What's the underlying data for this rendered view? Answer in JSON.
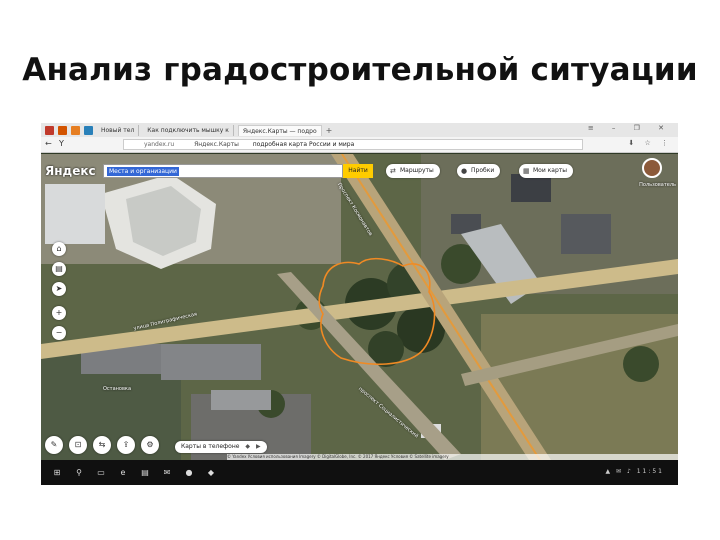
{
  "slide": {
    "title": "Анализ градостроительной ситуации"
  },
  "browser": {
    "tabs": [
      {
        "label": "Новый тел"
      },
      {
        "label": "Как подключить мышку к"
      },
      {
        "label": "Яндекс.Карты — подро"
      }
    ],
    "tab_plus": "+",
    "tab_controls": "≡ – ❐ ✕",
    "back_icon": "←",
    "address_prefix": "Y",
    "address_host": "yandex.ru",
    "address_title": "Яндекс.Карты",
    "address_query": "подробная карта России и мира",
    "address_right": "⬇ ☆ ⋮"
  },
  "map": {
    "logo": "Яндекс",
    "search_placeholder": "Места и организации",
    "search_button": "Найти",
    "routes_label": "Маршруты",
    "traffic_label": "Пробки",
    "layers_label": "Мои карты",
    "user_name": "Пользователь",
    "street_labels": [
      "Проспект Космонавтов",
      "улица Полиграфическая",
      "проспект Социалистический"
    ],
    "bus_stop_label": "Остановка",
    "controls": {
      "home": "⌂",
      "layers": "▤",
      "locate": "➤",
      "zoom_in": "+",
      "zoom_out": "−"
    },
    "bottom_tools": [
      "✎",
      "⊡",
      "⇆",
      "⇪",
      "⚙",
      "⋯"
    ],
    "phone_label": "Карты в телефоне",
    "phone_stores": " ",
    "copyright": "© Yandex  Условия использования  Imagery © DigitalGlobe, Inc.  © 2017 Яндекс  Условия  © Satellite imagery"
  },
  "taskbar": {
    "icons": [
      "⊞",
      "⚲",
      "▭",
      "e",
      "▤",
      "✉",
      "●",
      "◆"
    ],
    "right": "▲ ✉ ♪ 11:51"
  },
  "colors": {
    "accent_yellow": "#ffcc00",
    "selection_blue": "#3367d6",
    "highlight_orange": "#f08a24"
  }
}
